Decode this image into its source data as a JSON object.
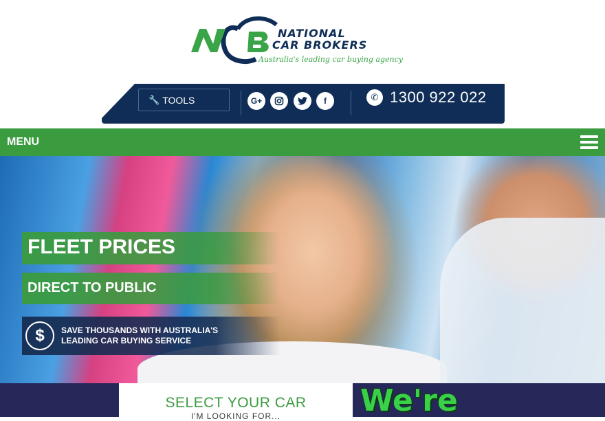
{
  "logo": {
    "monogram": "NCB",
    "line1": "NATIONAL",
    "line2": "CAR BROKERS",
    "tagline": "Australia's leading car buying agency",
    "colors": {
      "navy": "#0f2d56",
      "green": "#3aa548"
    }
  },
  "topbar": {
    "tools_label": "TOOLS",
    "tools_icon": "wrench-icon",
    "social": [
      {
        "name": "google-plus-icon",
        "glyph": "G+"
      },
      {
        "name": "instagram-icon",
        "glyph": "◎"
      },
      {
        "name": "twitter-icon",
        "glyph": "🐦"
      },
      {
        "name": "facebook-icon",
        "glyph": "f"
      }
    ],
    "phone_icon": "phone-icon",
    "phone_number": "1300 922 022"
  },
  "menu": {
    "label": "MENU",
    "toggle_icon": "hamburger-icon"
  },
  "hero": {
    "headline": "FLEET PRICES",
    "subheadline": "DIRECT TO PUBLIC",
    "promo_icon": "dollar-icon",
    "promo_line1": "SAVE THOUSANDS WITH AUSTRALIA'S",
    "promo_line2": "LEADING CAR BUYING SERVICE"
  },
  "bottom": {
    "select_title": "SELECT YOUR CAR",
    "select_subtitle": "I'M LOOKING FOR...",
    "were_text": "We're"
  },
  "colors": {
    "brand_green": "#3a9b3f",
    "brand_navy": "#0f2d56",
    "bottom_bg": "#27285a"
  }
}
